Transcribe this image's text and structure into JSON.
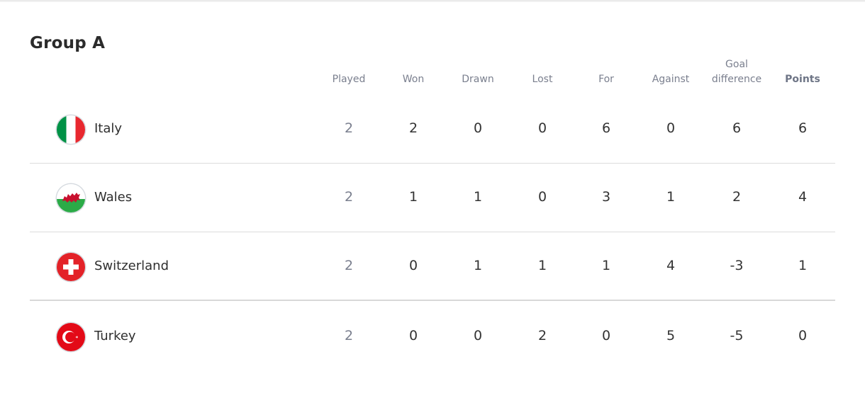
{
  "group": {
    "title": "Group A"
  },
  "columns": [
    {
      "key": "played",
      "label": "Played"
    },
    {
      "key": "won",
      "label": "Won"
    },
    {
      "key": "drawn",
      "label": "Drawn"
    },
    {
      "key": "lost",
      "label": "Lost"
    },
    {
      "key": "for",
      "label": "For"
    },
    {
      "key": "against",
      "label": "Against"
    },
    {
      "key": "goal_difference",
      "label_line1": "Goal",
      "label_line2": "difference"
    },
    {
      "key": "points",
      "label": "Points"
    }
  ],
  "teams": [
    {
      "name": "Italy",
      "flag": "italy-flag",
      "played": "2",
      "won": "2",
      "drawn": "0",
      "lost": "0",
      "for": "6",
      "against": "0",
      "goal_difference": "6",
      "points": "6"
    },
    {
      "name": "Wales",
      "flag": "wales-flag",
      "played": "2",
      "won": "1",
      "drawn": "1",
      "lost": "0",
      "for": "3",
      "against": "1",
      "goal_difference": "2",
      "points": "4"
    },
    {
      "name": "Switzerland",
      "flag": "switzerland-flag",
      "played": "2",
      "won": "0",
      "drawn": "1",
      "lost": "1",
      "for": "1",
      "against": "4",
      "goal_difference": "-3",
      "points": "1"
    },
    {
      "name": "Turkey",
      "flag": "turkey-flag",
      "played": "2",
      "won": "0",
      "drawn": "0",
      "lost": "2",
      "for": "0",
      "against": "5",
      "goal_difference": "-5",
      "points": "0"
    }
  ],
  "colors": {
    "italy_green": "#009246",
    "italy_red": "#ce2b37",
    "wales_green": "#27a844",
    "wales_red": "#c8102e",
    "swiss_red": "#e32228",
    "turkey_red": "#e30a17",
    "header_text": "#7a7f8e",
    "divider": "#dcdcdc"
  }
}
